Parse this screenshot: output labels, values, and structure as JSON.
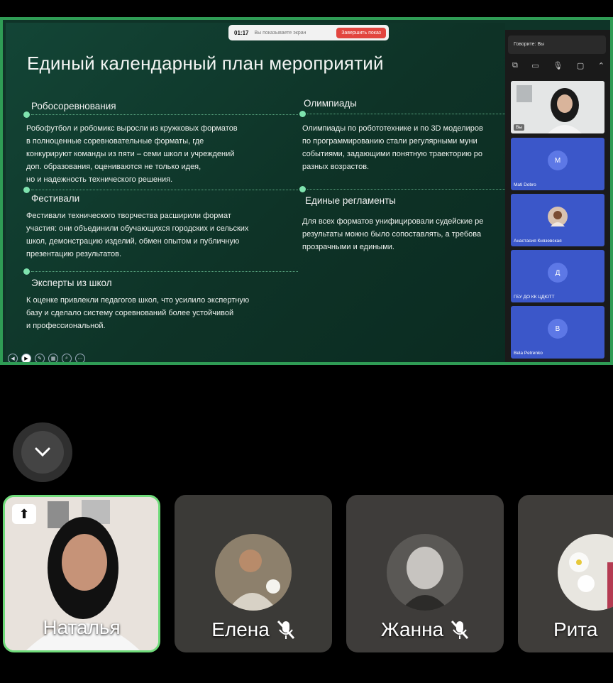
{
  "share_banner": {
    "time": "01:17",
    "info": "Вы показываете экран",
    "stop_label": "Завершить показ"
  },
  "slide": {
    "title": "Единый календарный план мероприятий",
    "sections": [
      {
        "heading": "Робосоревнования",
        "text": "Робофутбол и робомикс выросли из кружковых форматов\nв полноценные соревновательные форматы, где\nконкурируют команды из пяти – семи школ и учреждений\nдоп. образования, оцениваются не только идея,\nно и надежность технического решения."
      },
      {
        "heading": "Фестивали",
        "text": "Фестивали технического творчества расширили формат\nучастия: они объединили обучающихся городских и сельских\nшкол, демонстрацию изделий, обмен опытом и публичную\nпрезентацию результатов."
      },
      {
        "heading": "Эксперты из школ",
        "text": "К оценке привлекли педагогов школ, что усилило экспертную\nбазу и сделало систему соревнований более устойчивой\nи профессиональной."
      },
      {
        "heading": "Олимпиады",
        "text": "Олимпиады по робототехнике и по 3D моделиров\n по программированию стали регулярными муни\nсобытиями, задающими понятную траекторию ро\nразных возрастов."
      },
      {
        "heading": "Единые регламенты",
        "text": "Для всех форматов унифицировали судейские ре\nрезультаты можно было сопоставлять, а требова\nпрозрачными и едиными."
      }
    ]
  },
  "side_panel": {
    "speaking": "Говорите: Вы",
    "self_tile_label": "Вы",
    "participants": [
      {
        "initial": "M",
        "name": "Mati Dobro"
      },
      {
        "initial": "",
        "name": "Анастасия Князевская"
      },
      {
        "initial": "Д",
        "name": "ГБУ ДО КК ЦДЮТТ"
      },
      {
        "initial": "B",
        "name": "Bela Petrenko"
      }
    ]
  },
  "video_tiles": [
    {
      "name": "Наталья",
      "muted": false
    },
    {
      "name": "Елена",
      "muted": true
    },
    {
      "name": "Жанна",
      "muted": true
    },
    {
      "name": "Рита",
      "muted": false
    }
  ],
  "colors": {
    "slide_bg": "#0f3428",
    "share_border": "#2f9c55",
    "accent_dot": "#7ee3ae",
    "participant_tile": "#3b57c9",
    "stop_button": "#e2453f"
  }
}
